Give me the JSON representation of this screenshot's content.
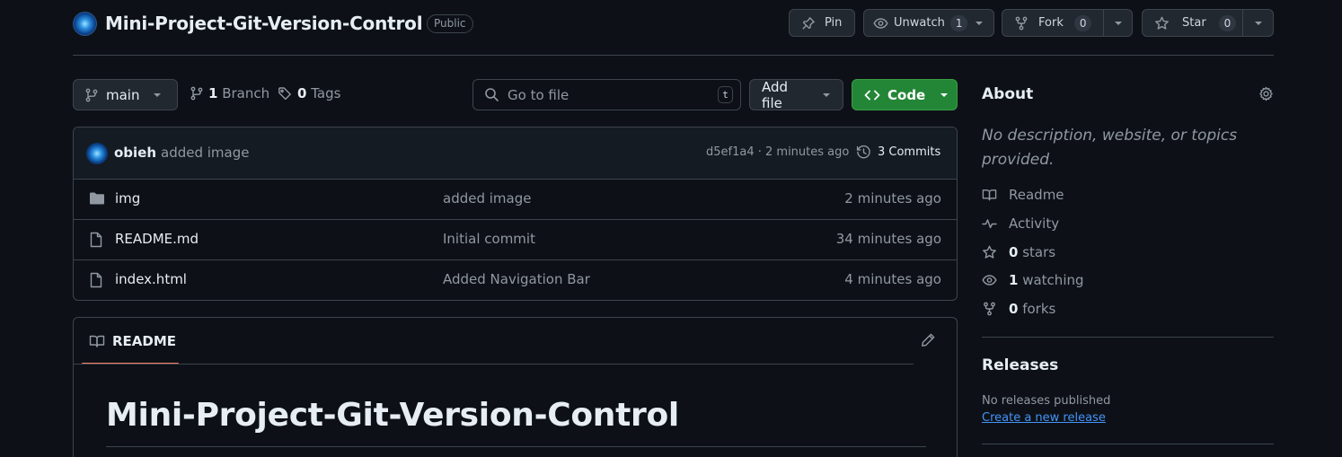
{
  "repo": {
    "name": "Mini-Project-Git-Version-Control",
    "visibility": "Public"
  },
  "header_actions": {
    "pin_label": "Pin",
    "unwatch_label": "Unwatch",
    "watch_count": "1",
    "fork_label": "Fork",
    "fork_count": "0",
    "star_label": "Star",
    "star_count": "0"
  },
  "toolbar": {
    "branch": "main",
    "branch_count": "1",
    "branch_word": "Branch",
    "tag_count": "0",
    "tag_word": "Tags",
    "search_placeholder": "Go to file",
    "search_shortcut": "t",
    "add_file_label": "Add file",
    "code_label": "Code"
  },
  "latest_commit": {
    "author": "obieh",
    "message": "added image",
    "meta": "d5ef1a4 · 2 minutes ago",
    "commits_label": "3 Commits"
  },
  "files": [
    {
      "name": "img",
      "type": "folder",
      "message": "added image",
      "time": "2 minutes ago"
    },
    {
      "name": "README.md",
      "type": "file",
      "message": "Initial commit",
      "time": "34 minutes ago"
    },
    {
      "name": "index.html",
      "type": "file",
      "message": "Added Navigation Bar",
      "time": "4 minutes ago"
    }
  ],
  "readme": {
    "tab_label": "README",
    "heading": "Mini-Project-Git-Version-Control"
  },
  "about": {
    "title": "About",
    "description": "No description, website, or topics provided.",
    "readme_label": "Readme",
    "activity_label": "Activity",
    "stars_count": "0",
    "stars_word": "stars",
    "watching_count": "1",
    "watching_word": "watching",
    "forks_count": "0",
    "forks_word": "forks"
  },
  "releases": {
    "title": "Releases",
    "none_text": "No releases published",
    "create_link": "Create a new release"
  },
  "colors": {
    "background": "#0d1117",
    "code_button": "#238636",
    "link": "#4493f8",
    "active_tab": "#f78166"
  }
}
